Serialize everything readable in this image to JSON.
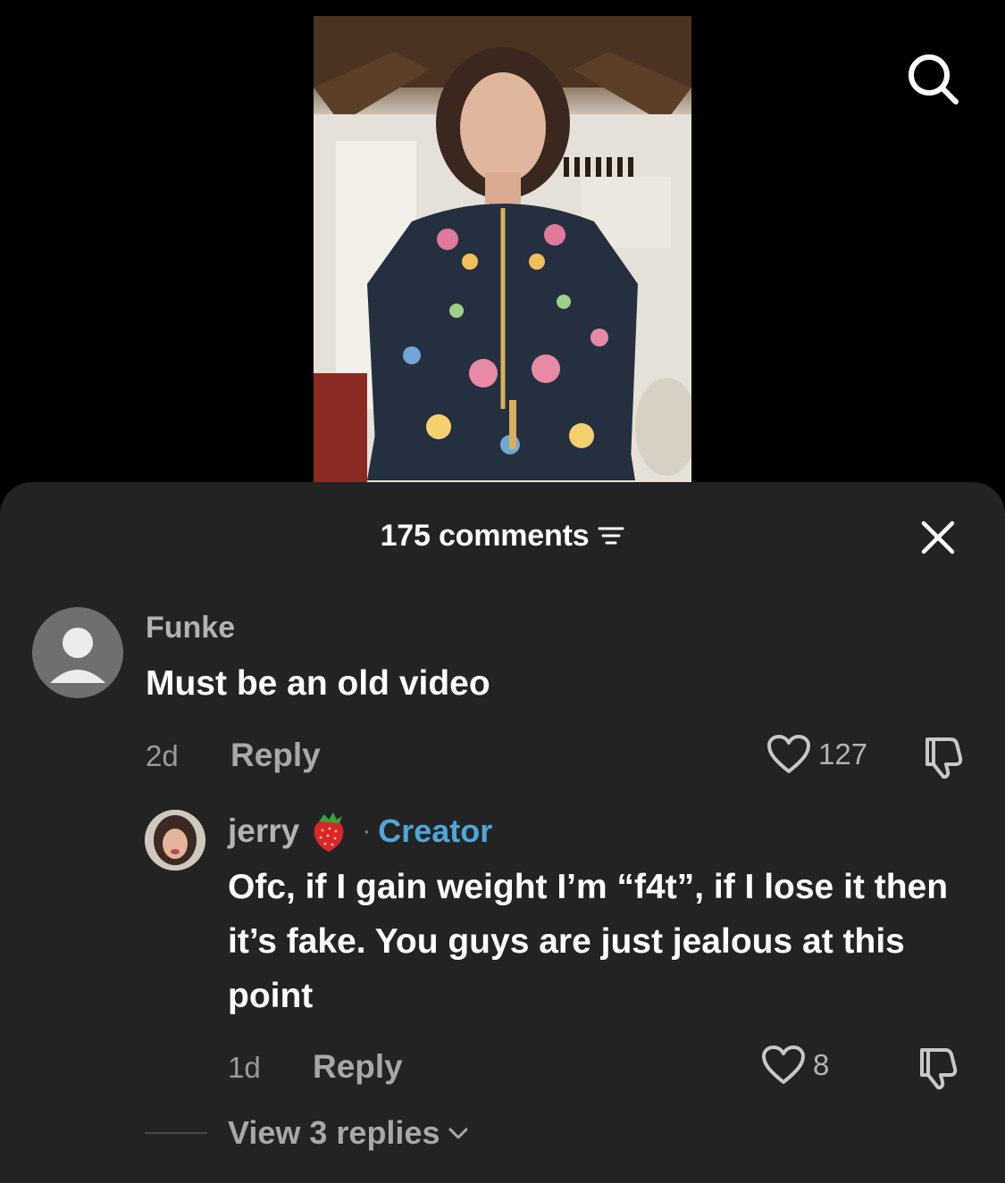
{
  "header": {
    "comments_count": "175 comments"
  },
  "comments": [
    {
      "username": "Funke",
      "text": "Must be an old video",
      "time": "2d",
      "reply_label": "Reply",
      "likes": "127"
    },
    {
      "username": "jerry",
      "emoji": "strawberry-icon",
      "separator": "·",
      "badge": "Creator",
      "text": "Ofc, if I gain weight I’m “f4t”, if I lose it then it’s fake. You guys are just jealous at this point",
      "time": "1d",
      "reply_label": "Reply",
      "likes": "8",
      "view_replies": "View 3 replies"
    }
  ],
  "colors": {
    "sheet_background": "#232323",
    "creator_badge": "#4ea6d9",
    "muted_text": "#b3b3b3"
  },
  "icons": [
    "search-icon",
    "filter-icon",
    "close-icon",
    "heart-icon",
    "dislike-icon",
    "chevron-down-icon",
    "default-avatar-icon",
    "strawberry-icon"
  ]
}
